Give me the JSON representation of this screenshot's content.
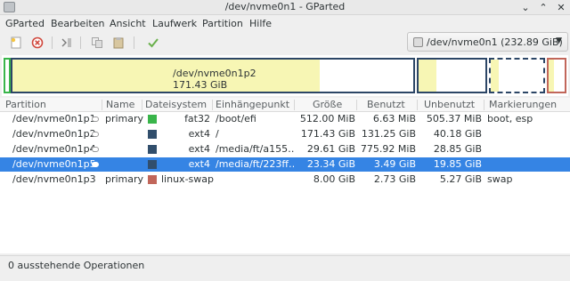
{
  "window": {
    "title": "/dev/nvme0n1 - GParted",
    "minimize": "⌄",
    "maximize": "⌃",
    "close": "✕"
  },
  "menu": [
    "GParted",
    "Bearbeiten",
    "Ansicht",
    "Laufwerk",
    "Partition",
    "Hilfe"
  ],
  "toolbar": {
    "icons": [
      "new-partition-icon",
      "delete-icon",
      "resize-move-icon",
      "copy-icon",
      "paste-icon",
      "apply-icon"
    ],
    "device_selector": "/dev/nvme0n1 (232.89 GiB)",
    "dropdown_arrow": "▼"
  },
  "map": {
    "selected_name": "/dev/nvme0n1p2",
    "selected_size": "171.43 GiB",
    "used_fractions": {
      "p2": 0.7657,
      "p4": 0.2625,
      "p5": 0.1495,
      "p3": 0.34
    }
  },
  "table": {
    "headers": [
      "Partition",
      "Name",
      "Dateisystem",
      "Einhängepunkt",
      "Größe",
      "Benutzt",
      "Unbenutzt",
      "Markierungen"
    ],
    "rows": [
      {
        "partition": "/dev/nvme0n1p1",
        "name": "primary",
        "fs": "fat32",
        "fs_color": "#39b54a",
        "mount": "/boot/efi",
        "size": "512.00 MiB",
        "used": "6.63 MiB",
        "unused": "505.37 MiB",
        "flags": "boot, esp",
        "key": true
      },
      {
        "partition": "/dev/nvme0n1p2",
        "name": "",
        "fs": "ext4",
        "fs_color": "#314e6c",
        "mount": "/",
        "size": "171.43 GiB",
        "used": "131.25 GiB",
        "unused": "40.18 GiB",
        "flags": "",
        "key": true
      },
      {
        "partition": "/dev/nvme0n1p4",
        "name": "",
        "fs": "ext4",
        "fs_color": "#314e6c",
        "mount": "/media/ft/a155…",
        "size": "29.61 GiB",
        "used": "775.92 MiB",
        "unused": "28.85 GiB",
        "flags": "",
        "key": true
      },
      {
        "partition": "/dev/nvme0n1p5",
        "name": "",
        "fs": "ext4",
        "fs_color": "#314e6c",
        "mount": "/media/ft/223ff…",
        "size": "23.34 GiB",
        "used": "3.49 GiB",
        "unused": "19.85 GiB",
        "flags": "",
        "key": true,
        "selected": true
      },
      {
        "partition": "/dev/nvme0n1p3",
        "name": "primary",
        "fs": "linux-swap",
        "fs_color": "#c1665a",
        "mount": "",
        "size": "8.00 GiB",
        "used": "2.73 GiB",
        "unused": "5.27 GiB",
        "flags": "swap",
        "key": false
      }
    ]
  },
  "status": "0 ausstehende Operationen",
  "colors": {
    "accent": "#3584e4",
    "ext4": "#314e6c",
    "fat32": "#39b54a",
    "swap": "#c1665a",
    "used": "#f7f6b4"
  }
}
